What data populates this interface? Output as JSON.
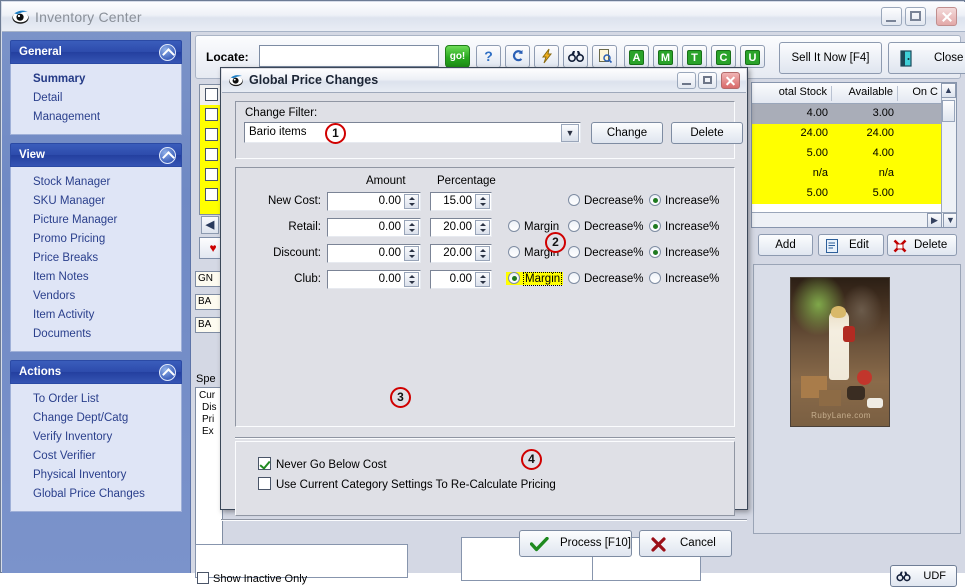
{
  "window": {
    "title": "Inventory Center",
    "controls": {
      "minimize": "minimize-button",
      "maximize": "maximize-button",
      "close": "close-button"
    }
  },
  "sidebar": {
    "panels": [
      {
        "title": "General",
        "items": [
          {
            "label": "Summary",
            "selected": true
          },
          {
            "label": "Detail",
            "selected": false
          },
          {
            "label": "Management",
            "selected": false
          }
        ]
      },
      {
        "title": "View",
        "items": [
          {
            "label": "Stock Manager",
            "selected": false
          },
          {
            "label": "SKU Manager",
            "selected": false
          },
          {
            "label": "Picture Manager",
            "selected": false
          },
          {
            "label": "Promo Pricing",
            "selected": false
          },
          {
            "label": "Price Breaks",
            "selected": false
          },
          {
            "label": "Item Notes",
            "selected": false
          },
          {
            "label": "Vendors",
            "selected": false
          },
          {
            "label": "Item Activity",
            "selected": false
          },
          {
            "label": "Documents",
            "selected": false
          }
        ]
      },
      {
        "title": "Actions",
        "items": [
          {
            "label": "To Order List",
            "selected": false
          },
          {
            "label": "Change Dept/Catg",
            "selected": false
          },
          {
            "label": "Verify Inventory",
            "selected": false
          },
          {
            "label": "Cost Verifier",
            "selected": false
          },
          {
            "label": "Physical Inventory",
            "selected": false
          },
          {
            "label": "Global Price Changes",
            "selected": false
          }
        ]
      }
    ]
  },
  "toolbar": {
    "locate_label": "Locate:",
    "locate_value": "",
    "locate_placeholder": "",
    "go_label": "go!",
    "icons": [
      {
        "name": "help-question-icon",
        "glyph": "?"
      },
      {
        "name": "refresh-arrow-icon",
        "glyph": "↶"
      },
      {
        "name": "lightning-bolt-icon",
        "glyph": "➦"
      },
      {
        "name": "binoculars-icon",
        "glyph": "Ж"
      },
      {
        "name": "document-preview-icon",
        "glyph": "❐"
      }
    ],
    "badges": [
      "A",
      "M",
      "T",
      "C",
      "U"
    ],
    "sell_it_now_label": "Sell It Now [F4]",
    "close_label": "Close"
  },
  "grid": {
    "columns": [
      "otal Stock",
      "Available",
      "On C"
    ],
    "rows": [
      {
        "total": "4.00",
        "available": "3.00",
        "onc": "",
        "state": "selected"
      },
      {
        "total": "24.00",
        "available": "24.00",
        "onc": "",
        "state": "highlight"
      },
      {
        "total": "5.00",
        "available": "4.00",
        "onc": "",
        "state": "highlight"
      },
      {
        "total": "n/a",
        "available": "n/a",
        "onc": "",
        "state": "highlight"
      },
      {
        "total": "5.00",
        "available": "5.00",
        "onc": "",
        "state": "highlight"
      }
    ],
    "buttons": {
      "add": "Add",
      "edit": "Edit",
      "delete": "Delete"
    }
  },
  "left_fields": [
    "GN",
    "BA",
    "BA"
  ],
  "spec_label": "Spe",
  "spec_list": [
    "Cur",
    "Dis",
    "Pri",
    "Ex"
  ],
  "footer": {
    "show_inactive_label": "Show Inactive Only",
    "show_inactive_checked": false,
    "udf_label": "UDF"
  },
  "picture": {
    "watermark": "RubyLane.com"
  },
  "dialog": {
    "title": "Global Price Changes",
    "filter": {
      "label": "Change Filter:",
      "value": "Bario items",
      "change_label": "Change",
      "delete_label": "Delete"
    },
    "columns": {
      "amount": "Amount",
      "percentage": "Percentage"
    },
    "rows": [
      {
        "label": "New Cost:",
        "amount": "0.00",
        "percentage": "15.00",
        "has_margin": false,
        "margin_label": "Margin",
        "margin_selected": false,
        "decrease_label": "Decrease%",
        "decrease_selected": false,
        "increase_label": "Increase%",
        "increase_selected": true
      },
      {
        "label": "Retail:",
        "amount": "0.00",
        "percentage": "20.00",
        "has_margin": true,
        "margin_label": "Margin",
        "margin_selected": false,
        "decrease_label": "Decrease%",
        "decrease_selected": false,
        "increase_label": "Increase%",
        "increase_selected": true
      },
      {
        "label": "Discount:",
        "amount": "0.00",
        "percentage": "20.00",
        "has_margin": true,
        "margin_label": "Margin",
        "margin_selected": false,
        "decrease_label": "Decrease%",
        "decrease_selected": false,
        "increase_label": "Increase%",
        "increase_selected": true
      },
      {
        "label": "Club:",
        "amount": "0.00",
        "percentage": "0.00",
        "has_margin": true,
        "margin_label": "Margin",
        "margin_selected": true,
        "margin_highlighted": true,
        "decrease_label": "Decrease%",
        "decrease_selected": false,
        "increase_label": "Increase%",
        "increase_selected": false
      }
    ],
    "options": [
      {
        "label": "Never Go Below Cost",
        "checked": true
      },
      {
        "label": "Use Current Category Settings To Re-Calculate Pricing",
        "checked": false
      }
    ],
    "actions": {
      "process": "Process  [F10]",
      "cancel": "Cancel"
    }
  },
  "annotations": [
    {
      "number": "1"
    },
    {
      "number": "2"
    },
    {
      "number": "3"
    },
    {
      "number": "4"
    }
  ],
  "colors": {
    "accent_blue": "#2d4bac",
    "sidebar_blue": "#7b93c8",
    "highlight_yellow": "#ffff00",
    "annotation_red": "#d00000",
    "go_green": "#28a81e"
  }
}
